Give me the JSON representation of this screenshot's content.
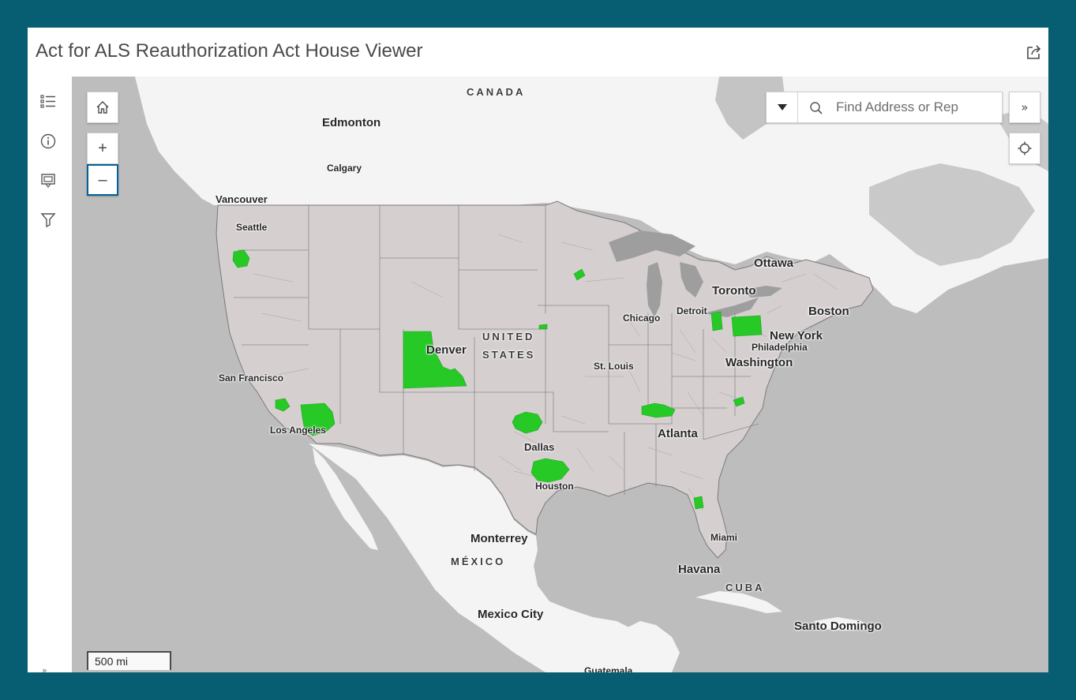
{
  "app": {
    "title": "Act for ALS Reauthorization Act House Viewer"
  },
  "header": {
    "share_icon": "share-icon"
  },
  "sidebar": {
    "items": [
      {
        "icon": "layer-list-icon",
        "name": "layers"
      },
      {
        "icon": "info-icon",
        "name": "about"
      },
      {
        "icon": "legend-icon",
        "name": "legend"
      },
      {
        "icon": "filter-icon",
        "name": "filter"
      }
    ],
    "collapse_label": "»"
  },
  "map_controls": {
    "home_icon": "home-icon",
    "zoom_in_label": "+",
    "zoom_out_label": "–",
    "locate_icon": "locate-icon",
    "expand_label": "»"
  },
  "search": {
    "placeholder": "Find Address or Rep",
    "value": ""
  },
  "scale": {
    "label": "500 mi"
  },
  "colors": {
    "frame": "#075e72",
    "land_us": "#d6cfd0",
    "land_other": "#f5f5f5",
    "water": "#bdbdbd",
    "highlight": "#26c926"
  },
  "labels": {
    "canada": "CANADA",
    "edmonton": "Edmonton",
    "calgary": "Calgary",
    "vancouver": "Vancouver",
    "seattle": "Seattle",
    "ottawa": "Ottawa",
    "toronto": "Toronto",
    "detroit": "Detroit",
    "boston": "Boston",
    "chicago": "Chicago",
    "new_york": "New York",
    "philadelphia": "Philadelphia",
    "washington": "Washington",
    "united": "UNITED",
    "states": "STATES",
    "denver": "Denver",
    "st_louis": "St. Louis",
    "san_francisco": "San Francisco",
    "los_angeles": "Los Angeles",
    "atlanta": "Atlanta",
    "dallas": "Dallas",
    "houston": "Houston",
    "miami": "Miami",
    "monterrey": "Monterrey",
    "mexico": "MÉXICO",
    "havana": "Havana",
    "cuba": "CUBA",
    "mexico_city": "Mexico City",
    "santo_domingo": "Santo Domingo",
    "guatemala": "Guatemala"
  }
}
